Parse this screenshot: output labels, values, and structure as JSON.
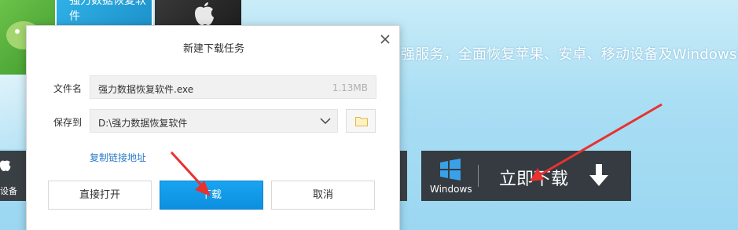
{
  "background": {
    "tile_text": "强力数据恢复软件",
    "tagline": "强服务，全面恢复苹果、安卓、移动设备及Windows数据",
    "left_strip_label": "设备",
    "download_box": {
      "os_label": "Windows",
      "button_text": "立即下载"
    }
  },
  "dialog": {
    "title": "新建下载任务",
    "filename_label": "文件名",
    "filename_value": "强力数据恢复软件.exe",
    "file_size": "1.13MB",
    "saveto_label": "保存到",
    "saveto_value": "D:\\强力数据恢复软件",
    "copy_link": "复制链接地址",
    "btn_open": "直接打开",
    "btn_download": "下载",
    "btn_cancel": "取消"
  },
  "colors": {
    "accent_blue": "#0c8fe0",
    "link_blue": "#2a7cc7",
    "annotation_red": "#e8322f",
    "dark_panel": "#353b41"
  },
  "icons": [
    "close-icon",
    "chevron-down-icon",
    "folder-icon",
    "windows-logo-icon",
    "download-arrow-icon",
    "apple-icon",
    "android-icon"
  ]
}
